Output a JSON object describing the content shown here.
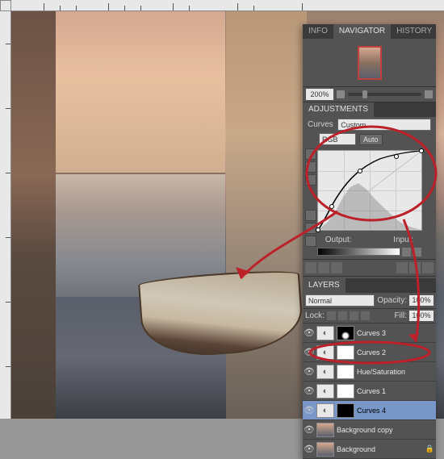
{
  "tabs": {
    "nav": [
      "INFO",
      "NAVIGATOR",
      "HISTORY"
    ],
    "active_nav": 1,
    "adj": "ADJUSTMENTS",
    "layers": "LAYERS"
  },
  "zoom": "200%",
  "adjustments": {
    "title": "Curves",
    "preset": "Custom",
    "channel": "RGB",
    "auto": "Auto",
    "output": "Output:",
    "input": "Input:",
    "colors": {
      "line": "#000000"
    }
  },
  "chart_data": {
    "type": "line",
    "title": "Curves",
    "xlabel": "Input",
    "ylabel": "Output",
    "xlim": [
      0,
      255
    ],
    "ylim": [
      0,
      255
    ],
    "series": [
      {
        "name": "RGB",
        "x": [
          0,
          32,
          105,
          195,
          255
        ],
        "y": [
          0,
          78,
          190,
          238,
          255
        ]
      }
    ],
    "histogram": {
      "x": [
        0,
        20,
        40,
        60,
        80,
        100,
        120,
        140,
        160,
        180,
        200,
        220,
        240,
        255
      ],
      "h": [
        2,
        12,
        35,
        68,
        90,
        98,
        85,
        65,
        48,
        32,
        18,
        9,
        3,
        0
      ]
    }
  },
  "layers": {
    "blend": "Normal",
    "opacity_lbl": "Opacity:",
    "opacity": "100%",
    "lock_lbl": "Lock:",
    "fill_lbl": "Fill:",
    "fill": "100%",
    "items": [
      {
        "name": "Curves 3",
        "type": "adj",
        "mask": "mk"
      },
      {
        "name": "Curves 2",
        "type": "adj",
        "mask": "w"
      },
      {
        "name": "Hue/Saturation",
        "type": "adj",
        "mask": "w"
      },
      {
        "name": "Curves 1",
        "type": "adj",
        "mask": "w"
      },
      {
        "name": "Curves 4",
        "type": "adj",
        "mask": "blk",
        "active": true
      },
      {
        "name": "Background copy",
        "type": "img"
      },
      {
        "name": "Background",
        "type": "img",
        "locked": true
      }
    ]
  }
}
